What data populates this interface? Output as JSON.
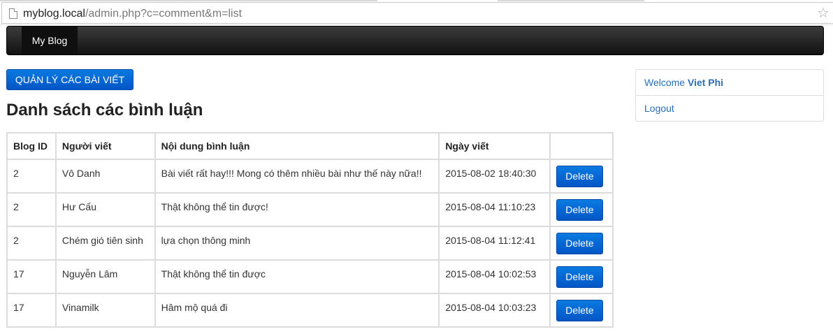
{
  "browser": {
    "url_host": "myblog.local",
    "url_path": "/admin.php?c=comment&m=list"
  },
  "navbar": {
    "brand": "My Blog"
  },
  "main": {
    "manage_button": "QUẢN LÝ CÁC BÀI VIẾT",
    "title": "Danh sách các bình luận",
    "table": {
      "headers": [
        "Blog ID",
        "Người viết",
        "Nội dung bình luận",
        "Ngày viết",
        ""
      ],
      "rows": [
        {
          "blog_id": "2",
          "author": "Vô Danh",
          "content": "Bài viết rất hay!!! Mong có thêm nhiều bài như thế này nữa!!",
          "date": "2015-08-02 18:40:30",
          "action": "Delete"
        },
        {
          "blog_id": "2",
          "author": "Hư Cấu",
          "content": "Thật không thể tin được!",
          "date": "2015-08-04 11:10:23",
          "action": "Delete"
        },
        {
          "blog_id": "2",
          "author": "Chém gió tiên sinh",
          "content": "lựa chọn thông minh",
          "date": "2015-08-04 11:12:41",
          "action": "Delete"
        },
        {
          "blog_id": "17",
          "author": "Nguyễn Lâm",
          "content": "Thật không thể tin được",
          "date": "2015-08-04 10:02:53",
          "action": "Delete"
        },
        {
          "blog_id": "17",
          "author": "Vinamilk",
          "content": "Hâm mộ quá đi",
          "date": "2015-08-04 10:03:23",
          "action": "Delete"
        }
      ]
    }
  },
  "sidebar": {
    "welcome_label": "Welcome",
    "user_name": "Viet Phi",
    "logout": "Logout"
  },
  "icons": {
    "page": "page-icon",
    "bookmark": "star-icon"
  }
}
